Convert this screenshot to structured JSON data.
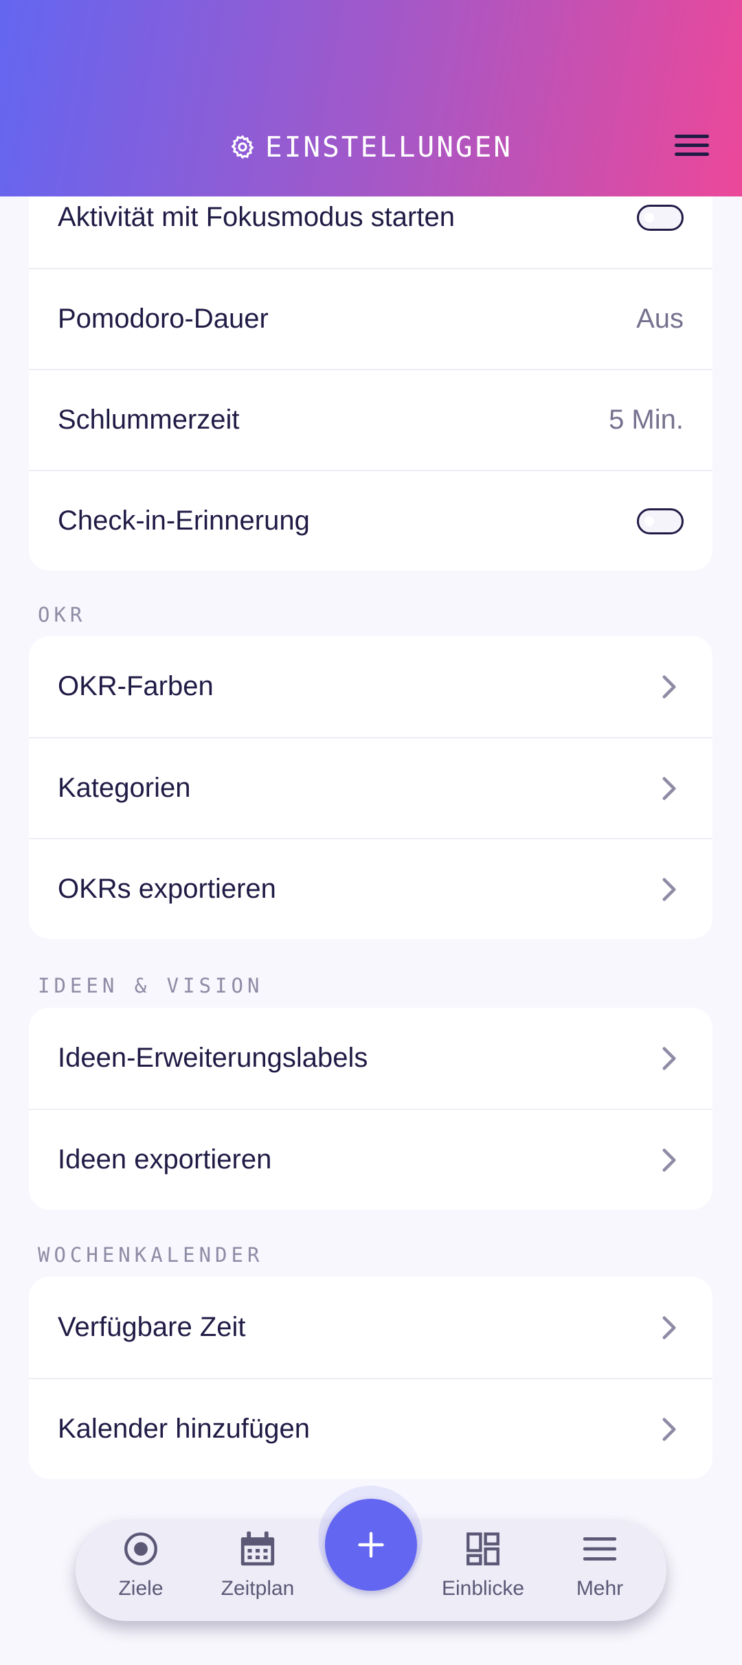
{
  "header": {
    "title": "EINSTELLUNGEN",
    "title_icon": "gear-icon",
    "menu_icon": "hamburger-menu-icon"
  },
  "general": {
    "items": [
      {
        "label": "Aktivität mit Fokusmodus starten",
        "type": "toggle",
        "on": false
      },
      {
        "label": "Pomodoro-Dauer",
        "value": "Aus"
      },
      {
        "label": "Schlummerzeit",
        "value": "5 Min."
      },
      {
        "label": "Check-in-Erinnerung",
        "type": "toggle",
        "on": false
      }
    ]
  },
  "okr": {
    "title": "OKR",
    "items": [
      {
        "label": "OKR-Farben"
      },
      {
        "label": "Kategorien"
      },
      {
        "label": "OKRs exportieren"
      }
    ]
  },
  "ideas": {
    "title": "IDEEN & VISION",
    "items": [
      {
        "label": "Ideen-Erweiterungslabels"
      },
      {
        "label": "Ideen exportieren"
      }
    ]
  },
  "calendar": {
    "title": "WOCHENKALENDER",
    "items": [
      {
        "label": "Verfügbare Zeit"
      },
      {
        "label": "Kalender hinzufügen"
      }
    ]
  },
  "bottom_nav": {
    "items": [
      {
        "label": "Ziele",
        "icon": "target-icon"
      },
      {
        "label": "Zeitplan",
        "icon": "calendar-icon"
      },
      {
        "label": "Einblicke",
        "icon": "dashboard-icon"
      },
      {
        "label": "Mehr",
        "icon": "menu-icon"
      }
    ],
    "fab_icon": "plus-icon"
  },
  "colors": {
    "accent": "#6366f1",
    "gradient_end": "#ec4899",
    "text_primary": "#1f1b45",
    "text_secondary": "#75728f"
  }
}
